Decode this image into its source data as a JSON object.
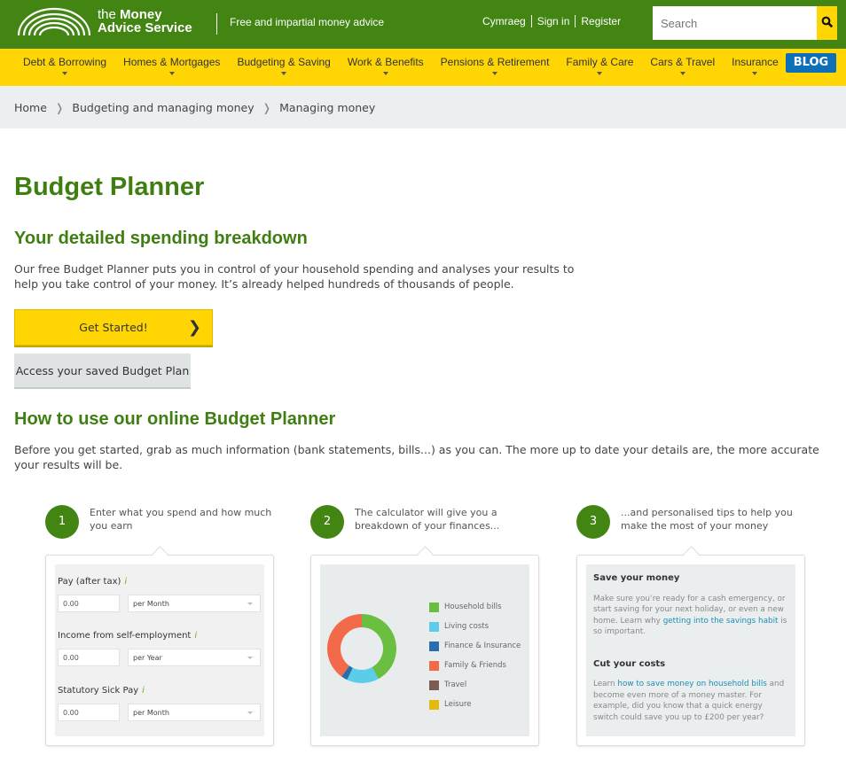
{
  "header": {
    "logo_line1_pre": "the",
    "logo_line1": "Money",
    "logo_line2": "Advice Service",
    "tagline": "Free and impartial money advice",
    "links": [
      "Cymraeg",
      "Sign in",
      "Register"
    ],
    "search_placeholder": "Search"
  },
  "nav": {
    "items": [
      "Debt & Borrowing",
      "Homes & Mortgages",
      "Budgeting & Saving",
      "Work & Benefits",
      "Pensions & Retirement",
      "Family & Care",
      "Cars & Travel",
      "Insurance"
    ],
    "blog": "BLOG",
    "blog_color": "#0d6fb8"
  },
  "breadcrumb": [
    "Home",
    "Budgeting and managing money",
    "Managing money"
  ],
  "page": {
    "title": "Budget Planner",
    "subtitle": "Your detailed spending breakdown",
    "intro": "Our free Budget Planner puts you in control of your household spending and analyses your results to help you take control of your money. It’s already helped hundreds of thousands of people.",
    "start_button": "Get Started!",
    "saved_button": "Access your saved Budget Plan",
    "how_title": "How to use our online Budget Planner",
    "how_text": "Before you get started, grab as much information (bank statements, bills...) as you can. The more up to date your details are, the more accurate your results will be."
  },
  "steps": [
    {
      "number": "1",
      "text": "Enter what you spend and how much you earn",
      "fields": [
        {
          "label": "Pay (after tax)",
          "value": "0.00",
          "period": "per Month"
        },
        {
          "label": "Income from self-employment",
          "value": "0.00",
          "period": "per Year"
        },
        {
          "label": "Statutory Sick Pay",
          "value": "0.00",
          "period": "per Month"
        }
      ],
      "info_icon": "i"
    },
    {
      "number": "2",
      "text": "The calculator will give you a breakdown of your finances...",
      "legend": [
        {
          "label": "Household bills",
          "color": "#6abf40",
          "share": 42
        },
        {
          "label": "Living costs",
          "color": "#5bcdea",
          "share": 15
        },
        {
          "label": "Finance & Insurance",
          "color": "#2a6ead",
          "share": 3
        },
        {
          "label": "Family & Friends",
          "color": "#f36a4a",
          "share": 40
        },
        {
          "label": "Travel",
          "color": "#7b5b52",
          "share": 0
        },
        {
          "label": "Leisure",
          "color": "#e6b90f",
          "share": 0
        }
      ]
    },
    {
      "number": "3",
      "text": "...and personalised tips to help you make the most of your money",
      "tips": [
        {
          "title": "Save your money",
          "pre": "Make sure you’re ready for a cash emergency, or start saving for your next holiday, or even a new home. Learn why ",
          "link": "getting into the savings habit",
          "post": " is so important."
        },
        {
          "title": "Cut your costs",
          "pre": "Learn ",
          "link": "how to save money on household bills",
          "post": " and become even more of a money master. For example, did you know that a quick energy switch could save you up to £200 per year?"
        }
      ]
    }
  ]
}
